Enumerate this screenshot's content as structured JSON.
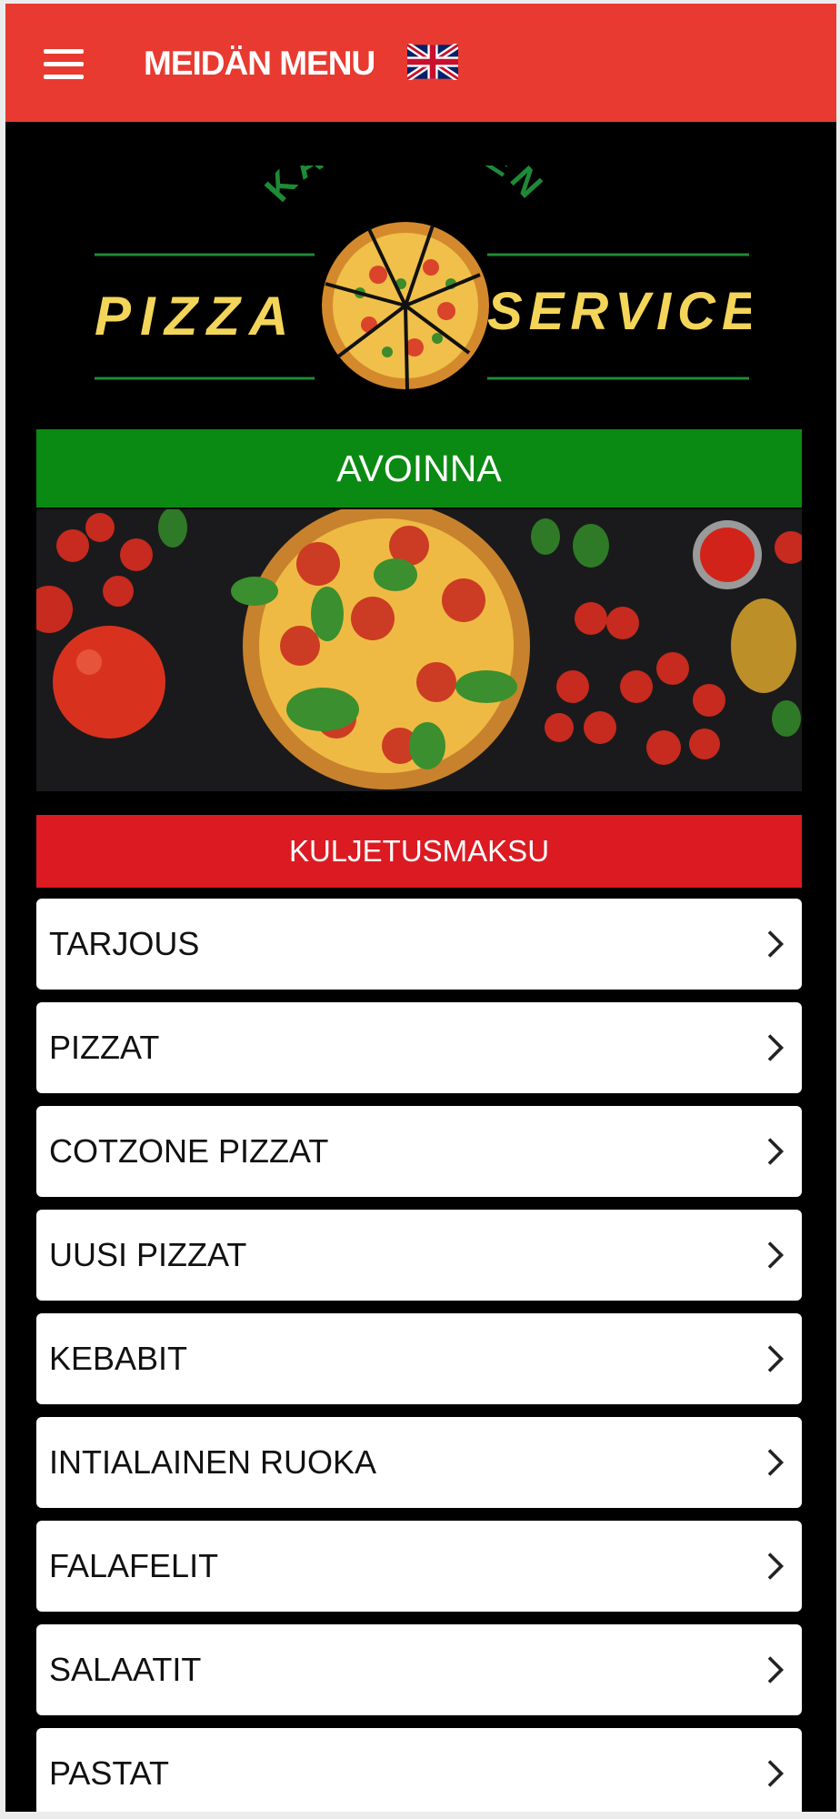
{
  "header": {
    "title": "MEIDÄN MENU",
    "menu_icon": "hamburger-icon",
    "language_icon": "uk-flag-icon",
    "color": "#e83a30"
  },
  "logo": {
    "text_top": "KAUNIAINEN",
    "text_left": "PIZZA",
    "text_right": "SERVICE"
  },
  "status": {
    "label": "AVOINNA",
    "color": "#0a8a12"
  },
  "delivery": {
    "label": "KULJETUSMAKSU",
    "color": "#dc1a22"
  },
  "menu": {
    "chevron_icon": "chevron-right-icon",
    "items": [
      {
        "label": "TARJOUS"
      },
      {
        "label": "PIZZAT"
      },
      {
        "label": "COTZONE PIZZAT"
      },
      {
        "label": "UUSI PIZZAT"
      },
      {
        "label": "KEBABIT"
      },
      {
        "label": "INTIALAINEN RUOKA"
      },
      {
        "label": "FALAFELIT"
      },
      {
        "label": "SALAATIT"
      },
      {
        "label": "PASTAT"
      }
    ]
  }
}
